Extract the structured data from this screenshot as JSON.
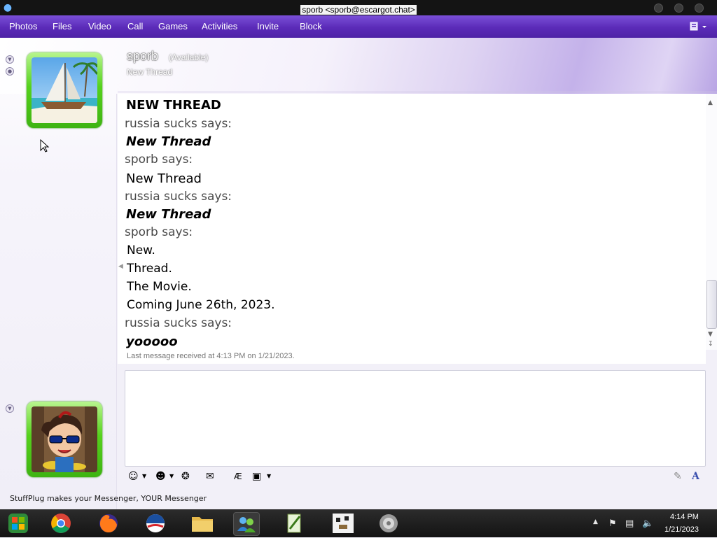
{
  "window": {
    "title": "sporb <sporb@escargot.chat>"
  },
  "menu": [
    "Photos",
    "Files",
    "Video",
    "Call",
    "Games",
    "Activities",
    "Invite",
    "Block"
  ],
  "contact": {
    "name": "sporb",
    "status": "(Available)",
    "personal_message": "New Thread"
  },
  "conversation": {
    "lines": [
      {
        "kind": "msg-bold",
        "text": "NEW THREAD"
      },
      {
        "kind": "say",
        "text": "russia sucks says:"
      },
      {
        "kind": "msg-bi",
        "text": "New Thread"
      },
      {
        "kind": "say",
        "text": "sporb says:"
      },
      {
        "kind": "msg-bold",
        "text": "New Thread"
      },
      {
        "kind": "say",
        "text": "russia sucks says:"
      },
      {
        "kind": "msg-bi",
        "text": "New Thread"
      },
      {
        "kind": "say",
        "text": "sporb says:"
      },
      {
        "kind": "msg",
        "text": "New."
      },
      {
        "kind": "msg",
        "text": "Thread."
      },
      {
        "kind": "msg",
        "text": "The Movie."
      },
      {
        "kind": "msg",
        "text": "Coming June 26th, 2023."
      },
      {
        "kind": "say",
        "text": "russia sucks says:"
      },
      {
        "kind": "msg-bi",
        "text": "yooooo"
      }
    ],
    "last_received": "Last message received at 4:13 PM on 1/21/2023."
  },
  "footer": {
    "tip": "StuffPlug makes your Messenger, YOUR Messenger"
  },
  "taskbar": {
    "apps": [
      "start-orb",
      "chrome",
      "firefox",
      "obama-logo",
      "file-explorer",
      "messenger",
      "notepad-plus-plus",
      "pixel-dog",
      "speaker-app"
    ],
    "clock_time": "4:14 PM",
    "clock_date": "1/21/2023"
  },
  "colors": {
    "menu_bar": "#5b2bb8",
    "avatar_frame": "#56d21d",
    "taskbar": "#131313"
  }
}
